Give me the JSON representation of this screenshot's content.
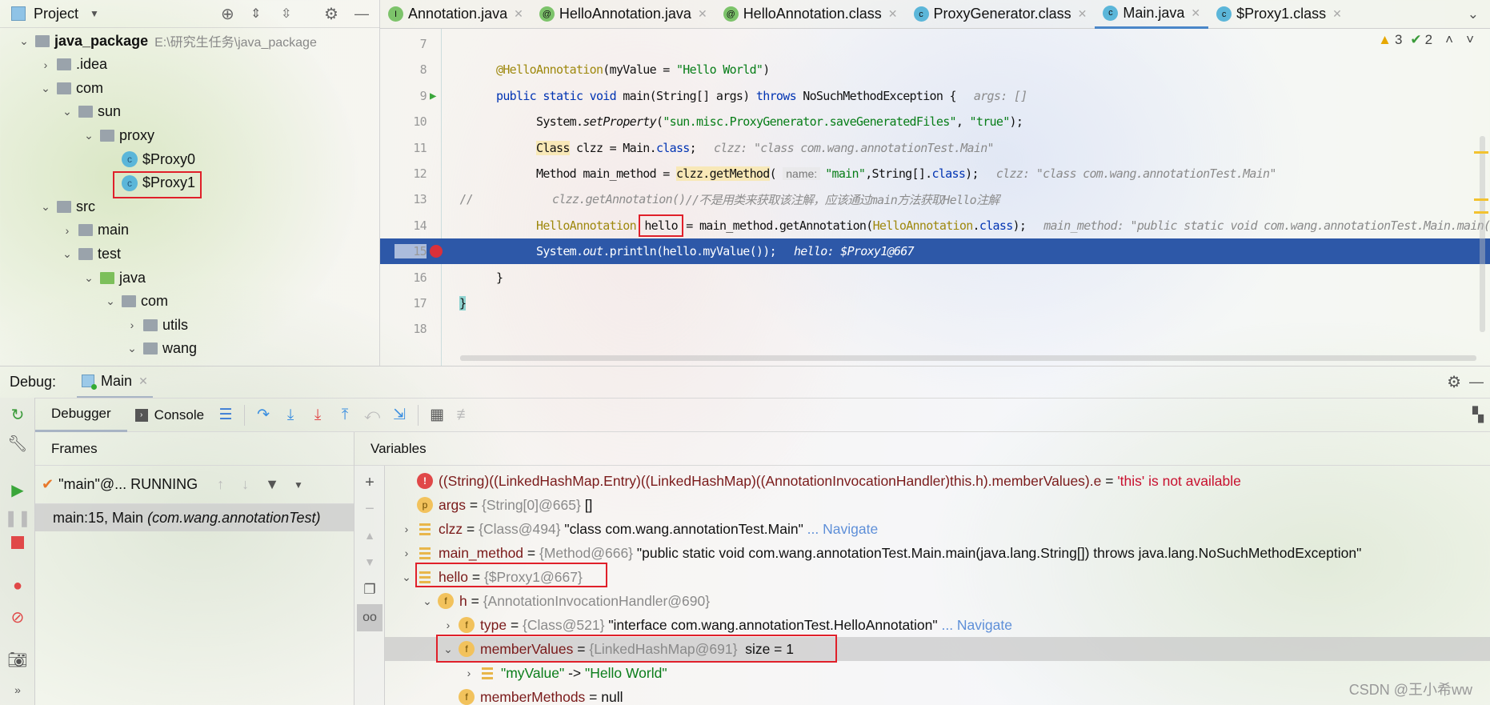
{
  "project": {
    "title": "Project",
    "tree": [
      {
        "label": "java_package",
        "path": "E:\\研究生任务\\java_package",
        "chev": "v",
        "kind": "module",
        "level": 0
      },
      {
        "label": ".idea",
        "chev": ">",
        "kind": "folder",
        "level": 1
      },
      {
        "label": "com",
        "chev": "v",
        "kind": "folder",
        "level": 1
      },
      {
        "label": "sun",
        "chev": "v",
        "kind": "folder",
        "level": 2
      },
      {
        "label": "proxy",
        "chev": "v",
        "kind": "folder",
        "level": 3
      },
      {
        "label": "$Proxy0",
        "chev": "",
        "kind": "class",
        "level": 4
      },
      {
        "label": "$Proxy1",
        "chev": "",
        "kind": "class",
        "level": 4
      },
      {
        "label": "src",
        "chev": "v",
        "kind": "folder",
        "level": 1
      },
      {
        "label": "main",
        "chev": ">",
        "kind": "folder",
        "level": 2
      },
      {
        "label": "test",
        "chev": "v",
        "kind": "folder",
        "level": 2
      },
      {
        "label": "java",
        "chev": "v",
        "kind": "source-folder",
        "level": 3
      },
      {
        "label": "com",
        "chev": "v",
        "kind": "package",
        "level": 4
      },
      {
        "label": "utils",
        "chev": ">",
        "kind": "package",
        "level": 5
      },
      {
        "label": "wang",
        "chev": "v",
        "kind": "package",
        "level": 5
      }
    ]
  },
  "tabs": [
    {
      "label": "Annotation.java",
      "icon": "I",
      "color": "#7cc36a"
    },
    {
      "label": "HelloAnnotation.java",
      "icon": "@",
      "color": "#7cc36a"
    },
    {
      "label": "HelloAnnotation.class",
      "icon": "@",
      "color": "#7cc36a"
    },
    {
      "label": "ProxyGenerator.class",
      "icon": "c",
      "color": "#5bb6d9"
    },
    {
      "label": "Main.java",
      "icon": "c",
      "color": "#5bb6d9",
      "active": true
    },
    {
      "label": "$Proxy1.class",
      "icon": "c",
      "color": "#5bb6d9"
    }
  ],
  "inspections": {
    "warnings": "3",
    "checks": "2"
  },
  "code": [
    {
      "num": "7",
      "tokens": []
    },
    {
      "num": "8",
      "tokens": [
        {
          "t": "@HelloAnnotation",
          "c": "ann"
        },
        {
          "t": "(myValue = "
        },
        {
          "t": "\"Hello World\"",
          "c": "str"
        },
        {
          "t": ")"
        }
      ]
    },
    {
      "num": "9",
      "gutter": "run",
      "tokens": [
        {
          "t": "public static void ",
          "c": "kw"
        },
        {
          "t": "main(String[] args) "
        },
        {
          "t": "throws",
          "c": "kw"
        },
        {
          "t": " NoSuchMethodException {"
        },
        {
          "t": "args: []",
          "c": "hint"
        }
      ]
    },
    {
      "num": "10",
      "tokens": [
        {
          "t": "System."
        },
        {
          "t": "setProperty",
          "c": "it"
        },
        {
          "t": "("
        },
        {
          "t": "\"sun.misc.ProxyGenerator.saveGeneratedFiles\"",
          "c": "str"
        },
        {
          "t": ", "
        },
        {
          "t": "\"true\"",
          "c": "str"
        },
        {
          "t": ");"
        }
      ]
    },
    {
      "num": "11",
      "tokens": [
        {
          "t": "Class",
          "c": "hl"
        },
        {
          "t": " clzz = Main."
        },
        {
          "t": "class",
          "c": "kw"
        },
        {
          "t": ";"
        },
        {
          "t": "clzz: \"class com.wang.annotationTest.Main\"",
          "c": "hint"
        }
      ]
    },
    {
      "num": "12",
      "tokens": [
        {
          "t": "Method main_method = "
        },
        {
          "t": "clzz.getMethod",
          "c": "hl"
        },
        {
          "t": "( "
        },
        {
          "t": "name:",
          "c": "phint"
        },
        {
          "t": "\"main\"",
          "c": "str"
        },
        {
          "t": ",String[]."
        },
        {
          "t": "class",
          "c": "kw"
        },
        {
          "t": ");"
        },
        {
          "t": "clzz: \"class com.wang.annotationTest.Main\"",
          "c": "hint"
        }
      ]
    },
    {
      "num": "13",
      "prefix": "//",
      "tokens": [
        {
          "t": "clzz.getAnnotation()",
          "c": "cmt"
        },
        {
          "t": "//不是用类来获取该注解，应该通过main方法获取Hello注解",
          "c": "cmt"
        }
      ]
    },
    {
      "num": "14",
      "tokens": [
        {
          "t": "HelloAnnotation",
          "c": "ann"
        },
        {
          "t": " "
        },
        {
          "t": "hello",
          "c": "boxed"
        },
        {
          "t": " = main_method.getAnnotation("
        },
        {
          "t": "HelloAnnotation",
          "c": "ann"
        },
        {
          "t": "."
        },
        {
          "t": "class",
          "c": "kw"
        },
        {
          "t": ");"
        },
        {
          "t": "main_method: \"public static void com.wang.annotationTest.Main.main(java.lang.String[])\"",
          "c": "hint"
        }
      ]
    },
    {
      "num": "15",
      "gutter": "breakpoint",
      "current": true,
      "tokens": [
        {
          "t": "System."
        },
        {
          "t": "out",
          "c": "it"
        },
        {
          "t": ".println(hello.myValue());"
        },
        {
          "t": "hello: $Proxy1@667",
          "c": "hint"
        }
      ]
    },
    {
      "num": "16",
      "tokens": [
        {
          "t": "}"
        }
      ]
    },
    {
      "num": "17",
      "tokens": [
        {
          "t": "}",
          "c": "brace"
        }
      ]
    },
    {
      "num": "18",
      "tokens": []
    }
  ],
  "debug": {
    "label": "Debug:",
    "session": "Main",
    "tabs": {
      "debugger": "Debugger",
      "console": "Console"
    },
    "frames": {
      "title": "Frames",
      "thread": "\"main\"@... RUNNING",
      "items": [
        {
          "method": "main:15, Main",
          "pkg": "(com.wang.annotationTest)"
        }
      ]
    },
    "variables": {
      "title": "Variables",
      "rows": [
        {
          "level": 0,
          "chev": "",
          "icon": "error",
          "name": "((String)((LinkedHashMap.Entry)((LinkedHashMap)((AnnotationInvocationHandler)this.h).memberValues).e",
          "eq": " = ",
          "value": "'this' is not available",
          "kind": "error"
        },
        {
          "level": 0,
          "chev": "",
          "icon": "p",
          "name": "args",
          "eq": " = ",
          "ref": "{String[0]@665}",
          "value": " []"
        },
        {
          "level": 0,
          "chev": ">",
          "icon": "list",
          "name": "clzz",
          "eq": " = ",
          "ref": "{Class@494}",
          "value": " \"class com.wang.annotationTest.Main\"",
          "link": " ... Navigate"
        },
        {
          "level": 0,
          "chev": ">",
          "icon": "list",
          "name": "main_method",
          "eq": " = ",
          "ref": "{Method@666}",
          "value": " \"public static void com.wang.annotationTest.Main.main(java.lang.String[]) throws java.lang.NoSuchMethodException\""
        },
        {
          "level": 0,
          "chev": "v",
          "icon": "list",
          "name": "hello",
          "eq": " = ",
          "ref": "{$Proxy1@667}",
          "value": ""
        },
        {
          "level": 1,
          "chev": "v",
          "icon": "f",
          "name": "h",
          "eq": " = ",
          "ref": "{AnnotationInvocationHandler@690}",
          "value": ""
        },
        {
          "level": 2,
          "chev": ">",
          "icon": "f",
          "name": "type",
          "eq": " = ",
          "ref": "{Class@521}",
          "value": " \"interface com.wang.annotationTest.HelloAnnotation\"",
          "link": " ... Navigate"
        },
        {
          "level": 2,
          "chev": "v",
          "icon": "f",
          "name": "memberValues",
          "eq": " = ",
          "ref": "{LinkedHashMap@691}",
          "value": "  size = 1",
          "selected": true
        },
        {
          "level": 3,
          "chev": ">",
          "icon": "list",
          "name": "\"myValue\"",
          "eq": " -> ",
          "value": "\"Hello World\"",
          "kind": "entry"
        },
        {
          "level": 2,
          "chev": "",
          "icon": "f",
          "name": "memberMethods",
          "eq": " = ",
          "value": "null"
        }
      ]
    }
  },
  "watermark": "CSDN @王小希ww"
}
